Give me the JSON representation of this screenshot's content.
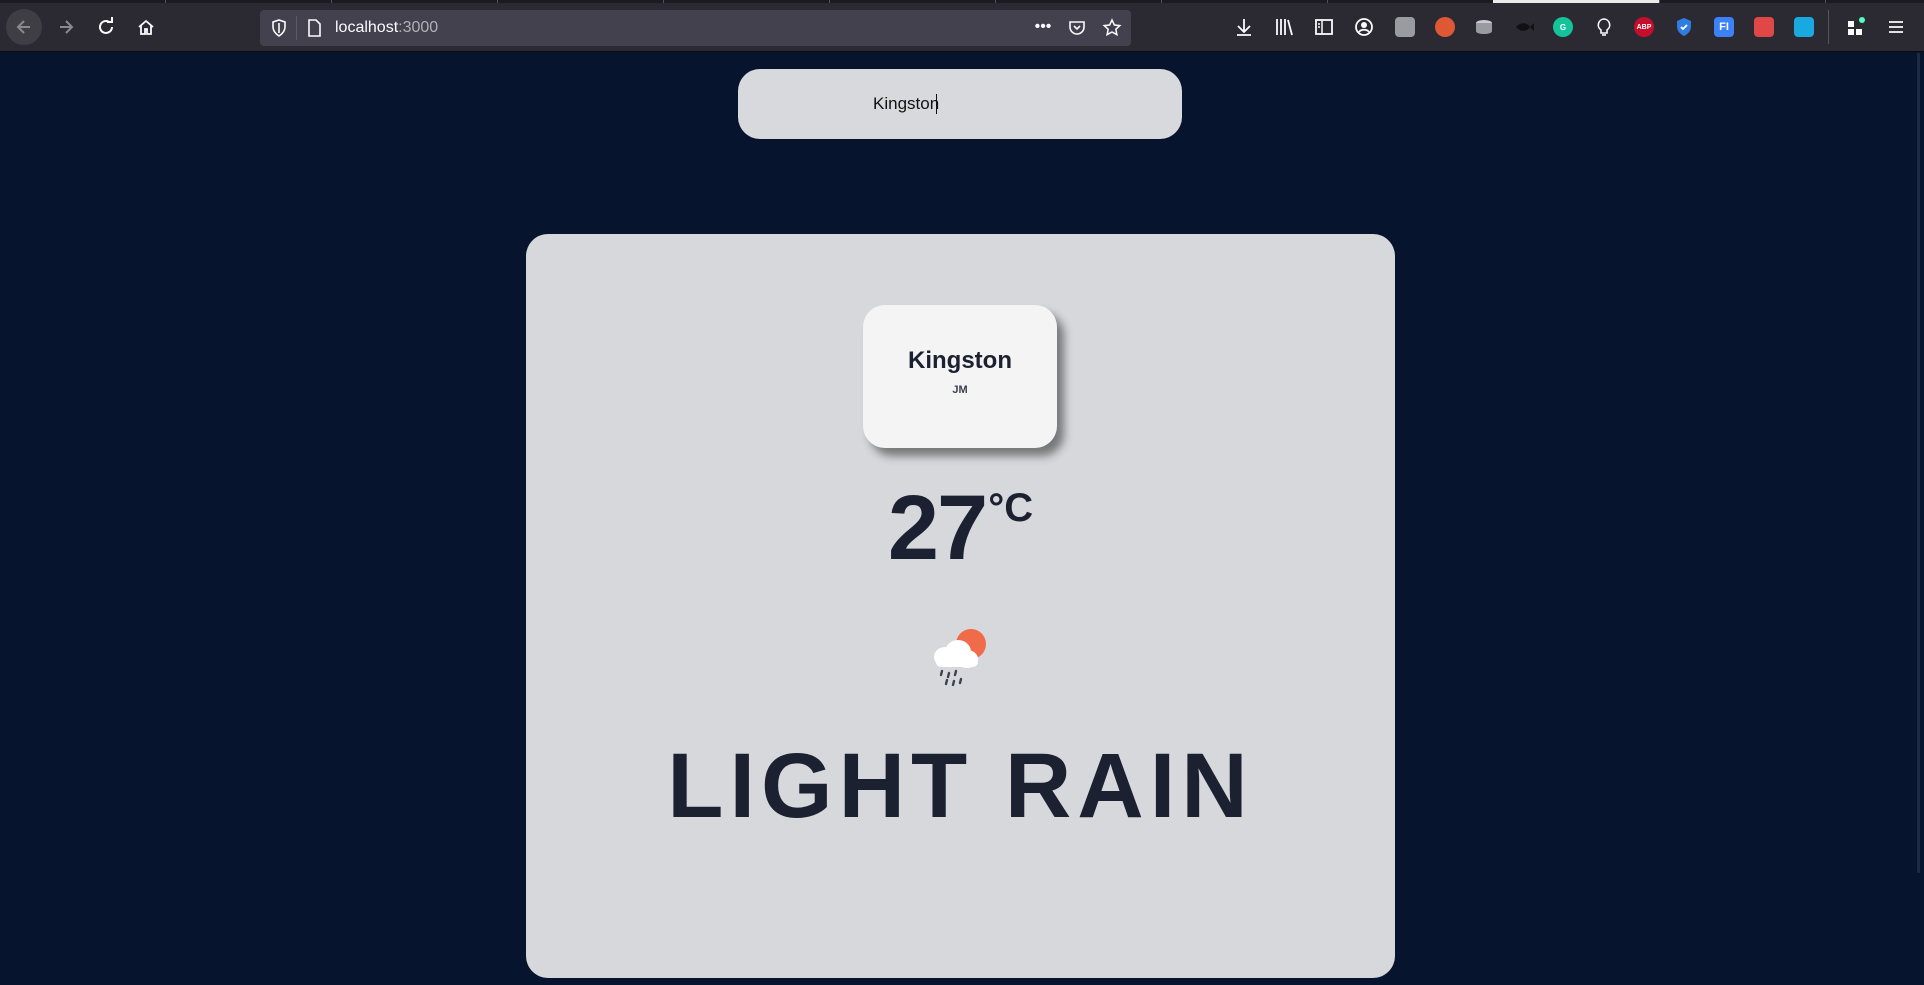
{
  "browser": {
    "url_host": "localhost",
    "url_port": ":3000",
    "more_label": "•••"
  },
  "toolbar_icons": [
    "downloads-icon",
    "library-icon",
    "sidebar-icon",
    "account-icon",
    "extension-icon",
    "duckduckgo-icon",
    "database-icon",
    "fish-icon",
    "grammarly-icon",
    "lightbulb-icon",
    "adblock-icon",
    "shield-icon",
    "fi-icon",
    "puzzle-icon",
    "capture-icon",
    "extensions-menu-icon",
    "hamburger-menu-icon"
  ],
  "ext_labels": {
    "grammarly": "G",
    "adblock": "ABP",
    "fi": "FI"
  },
  "search": {
    "value": "Kingston"
  },
  "weather": {
    "city": "Kingston",
    "country": "JM",
    "temperature": "27",
    "unit": "°C",
    "icon": "light-rain-icon",
    "description": "LIGHT RAIN"
  },
  "colors": {
    "page_background": "#07142d",
    "card_background": "#d7d8dc",
    "text": "#1b2131",
    "sun": "#ef6b4a"
  }
}
